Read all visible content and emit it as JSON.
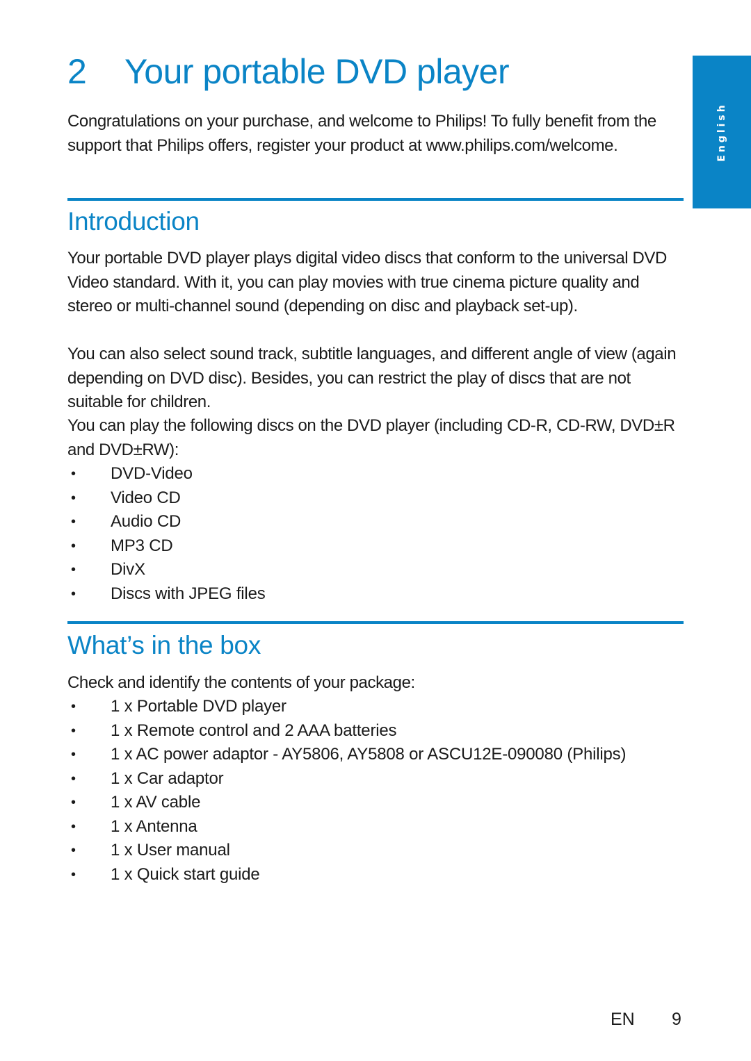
{
  "chapter": {
    "number": "2",
    "title": "Your portable DVD player",
    "intro": "Congratulations on your purchase, and welcome to Philips! To fully benefit from the support that Philips offers, register your product at www.philips.com/welcome."
  },
  "side_tab": {
    "label": "English",
    "color": "#0a84c6"
  },
  "colors": {
    "accent": "#0a84c6",
    "text": "#1a1a1a"
  },
  "sections": {
    "introduction": {
      "heading": "Introduction",
      "paragraphs": [
        "Your portable DVD player plays digital video discs that conform to the universal DVD Video standard. With it, you can play movies with true cinema picture quality and stereo or multi-channel sound (depending on disc and playback set-up).",
        "You can also select sound track, subtitle languages, and different angle of view (again depending on DVD disc). Besides, you can restrict the play of discs that are not suitable for children.",
        "You can play the following discs on the DVD player (including CD-R, CD-RW, DVD±R and DVD±RW):"
      ],
      "disc_types": [
        "DVD-Video",
        "Video CD",
        "Audio CD",
        "MP3 CD",
        "DivX",
        "Discs with JPEG files"
      ]
    },
    "whats_in_the_box": {
      "heading": "What’s in the box",
      "intro": "Check and identify the contents of your package:",
      "items": [
        "1 x Portable DVD player",
        "1 x Remote control and 2 AAA batteries",
        "1 x AC power adaptor - AY5806, AY5808 or ASCU12E-090080 (Philips)",
        "1 x Car adaptor",
        "1 x AV cable",
        "1 x Antenna",
        "1 x User manual",
        "1 x Quick start guide"
      ]
    }
  },
  "bullet_glyph": "•",
  "footer": {
    "language_code": "EN",
    "page_number": "9"
  }
}
